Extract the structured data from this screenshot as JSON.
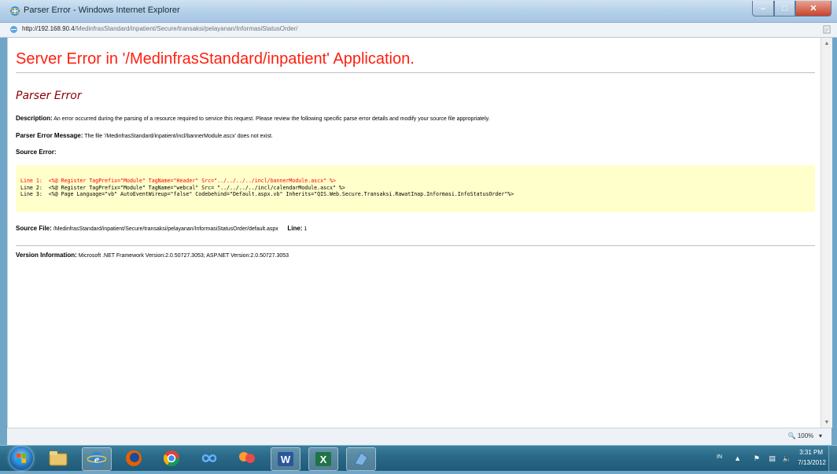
{
  "window": {
    "title": "Parser Error - Windows Internet Explorer",
    "address_host": "http://192.168.90.4",
    "address_path": "/MedinfrasStandard/inpatient/Secure/transaksi/pelayanan/InformasiStatusOrder/"
  },
  "page": {
    "heading": "Server Error in '/MedinfrasStandard/inpatient' Application.",
    "subheading": "Parser Error",
    "description_label": "Description:",
    "description_text": "An error occurred during the parsing of a resource required to service this request. Please review the following specific parse error details and modify your source file appropriately.",
    "message_label": "Parser Error Message:",
    "message_text": "The file '/MedinfrasStandard/inpatient/incl/bannerModule.ascx' does not exist.",
    "source_error_label": "Source Error:",
    "code_lines": [
      "Line 1:  <%@ Register TagPrefix=\"Module\" TagName=\"Header\" Src=\"../../../../incl/bannerModule.ascx\" %>",
      "Line 2:  <%@ Register TagPrefix=\"Module\" TagName=\"webcal\" Src= \"../../../../incl/calendarModule.ascx\" %>",
      "Line 3:  <%@ Page Language=\"vb\" AutoEventWireup=\"false\" Codebehind=\"Default.aspx.vb\" Inherits=\"QIS.Web.Secure.Transaksi.RawatInap.Informasi.InfoStatusOrder\"%>"
    ],
    "source_file_label": "Source File:",
    "source_file_text": "/MedinfrasStandard/inpatient/Secure/transaksi/pelayanan/InformasiStatusOrder/default.aspx",
    "line_label": "Line:",
    "line_value": "1",
    "version_label": "Version Information:",
    "version_text": "Microsoft .NET Framework Version:2.0.50727.3053; ASP.NET Version:2.0.50727.3053"
  },
  "statusbar": {
    "zoom": "100%"
  },
  "taskbar": {
    "language": "IN",
    "time": "3:31 PM",
    "date": "7/13/2012",
    "apps": [
      "explorer-icon",
      "internet-explorer-icon",
      "firefox-icon",
      "chrome-icon",
      "infinity-app-icon",
      "people-app-icon",
      "word-icon",
      "excel-icon",
      "document-app-icon"
    ]
  },
  "colors": {
    "heading": "#ff1f0f",
    "subheading": "#8b0000",
    "code_background": "#ffffcc",
    "error_line": "#ff0000"
  }
}
